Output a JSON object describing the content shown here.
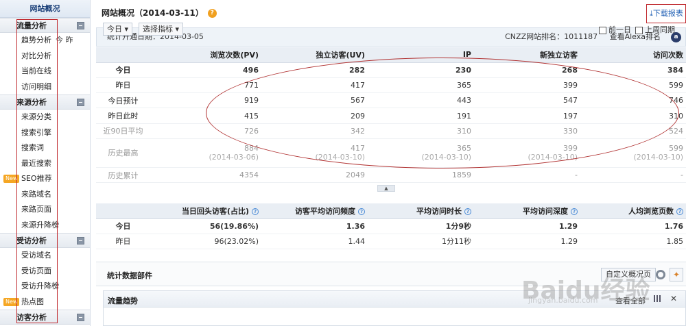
{
  "sidebar": {
    "title": "网站概况",
    "sections": [
      {
        "label": "流量分析",
        "items": [
          "趋势分析",
          "对比分析",
          "当前在线",
          "访问明细"
        ]
      },
      {
        "label": "来源分析",
        "items": [
          "来源分类",
          "搜索引擎",
          "搜索词",
          "最近搜索",
          "SEO推荐",
          "来路域名",
          "来路页面",
          "来源升降榜"
        ]
      },
      {
        "label": "受访分析",
        "items": [
          "受访域名",
          "受访页面",
          "受访升降榜",
          "热点图"
        ]
      },
      {
        "label": "访客分析"
      }
    ],
    "trend_extra": "今  昨",
    "new_badge": "New"
  },
  "header": {
    "title": "网站概况（2014-03-11）",
    "help": "?",
    "download": "下载报表"
  },
  "info": {
    "start_date": "统计开通日期：2014-03-05",
    "rank": "CNZZ网站排名：1011187",
    "alexa": "查看Alexa排名",
    "alexa_icon": "a"
  },
  "table1": {
    "headers": [
      "",
      "浏览次数(PV)",
      "独立访客(UV)",
      "IP",
      "新独立访客",
      "访问次数"
    ],
    "rows": [
      [
        "今日",
        "496",
        "282",
        "230",
        "268",
        "384"
      ],
      [
        "昨日",
        "771",
        "417",
        "365",
        "399",
        "599"
      ],
      [
        "今日预计",
        "919",
        "567",
        "443",
        "547",
        "746"
      ],
      [
        "昨日此时",
        "415",
        "209",
        "191",
        "197",
        "310"
      ],
      [
        "近90日平均",
        "726",
        "342",
        "310",
        "330",
        "524"
      ]
    ],
    "history_high": {
      "label": "历史最高",
      "values": [
        "884",
        "417",
        "365",
        "399",
        "599"
      ],
      "dates": [
        "(2014-03-06)",
        "(2014-03-10)",
        "(2014-03-10)",
        "(2014-03-10)",
        "(2014-03-10)"
      ]
    },
    "history_total": {
      "label": "历史累计",
      "values": [
        "4354",
        "2049",
        "1859",
        "-",
        "-"
      ]
    }
  },
  "table2": {
    "headers": [
      "",
      "当日回头访客(占比)",
      "访客平均访问频度",
      "平均访问时长",
      "平均访问深度",
      "人均浏览页数"
    ],
    "rows": [
      [
        "今日",
        "56(19.86%)",
        "1.36",
        "1分9秒",
        "1.29",
        "1.76"
      ],
      [
        "昨日",
        "96(23.02%)",
        "1.44",
        "1分11秒",
        "1.29",
        "1.85"
      ]
    ]
  },
  "widgets": {
    "title": "统计数据部件",
    "custom": "自定义概况页"
  },
  "trend": {
    "title": "流量趋势",
    "view_all": "查看全部",
    "period": "今日",
    "metric": "选择指标",
    "prev_day": "前一日",
    "last_week": "上周同期"
  },
  "watermark": {
    "main": "Baidu经验",
    "sub": "jingyan.baidu.com"
  }
}
